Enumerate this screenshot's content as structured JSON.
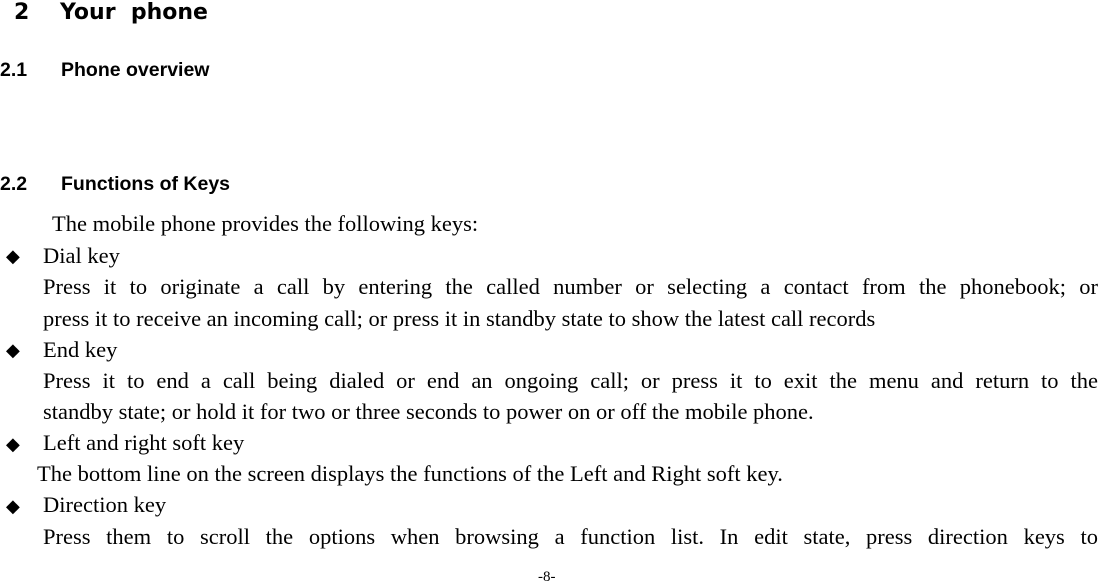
{
  "chapter": {
    "number": "2",
    "title": "Your  phone"
  },
  "sections": [
    {
      "number": "2.1",
      "title": "Phone overview"
    },
    {
      "number": "2.2",
      "title": "Functions of Keys"
    }
  ],
  "intro": "The mobile phone provides the following keys:",
  "bullet_glyph": "◆",
  "keys": [
    {
      "label": "Dial key",
      "lines": [
        "Press it to originate a call by entering the called number or selecting a contact from the phonebook; or",
        "press it to receive an incoming call; or press it in standby state to show the latest call records"
      ]
    },
    {
      "label": "End key",
      "lines": [
        "Press it to end a call being dialed or end an ongoing call; or press it to exit the menu and return to the",
        "standby state; or hold it for two or three seconds to power on or off the mobile phone."
      ]
    },
    {
      "label": "Left and right soft key",
      "lines": [
        "The bottom line on the screen displays the functions of the Left and Right soft key."
      ]
    },
    {
      "label": "Direction key",
      "lines": [
        "Press them to scroll the options when browsing a function list. In edit state, press direction keys to"
      ]
    }
  ],
  "page_number": "-8-"
}
